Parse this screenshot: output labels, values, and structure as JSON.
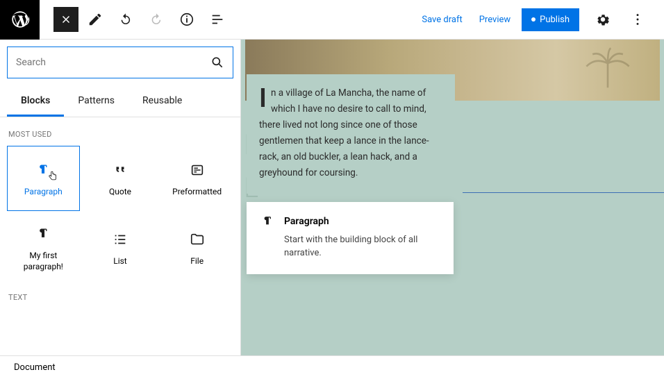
{
  "toolbar": {
    "save_draft": "Save draft",
    "preview": "Preview",
    "publish": "Publish"
  },
  "search": {
    "placeholder": "Search"
  },
  "tabs": {
    "blocks": "Blocks",
    "patterns": "Patterns",
    "reusable": "Reusable"
  },
  "sections": {
    "most_used": "MOST USED",
    "text": "TEXT"
  },
  "blocks": {
    "paragraph": "Paragraph",
    "quote": "Quote",
    "preformatted": "Preformatted",
    "my_first": "My first paragraph!",
    "list": "List",
    "file": "File"
  },
  "content": {
    "paragraph": "n a village of La Mancha, the name of which I have no desire to call to mind, there lived not long since one of those gentlemen that keep a lance in the lance-rack, an old buckler, a lean hack, and a greyhound for coursing.",
    "dropcap": "I"
  },
  "tooltip": {
    "title": "Paragraph",
    "desc": "Start with the building block of all narrative."
  },
  "bottombar": {
    "document": "Document"
  }
}
